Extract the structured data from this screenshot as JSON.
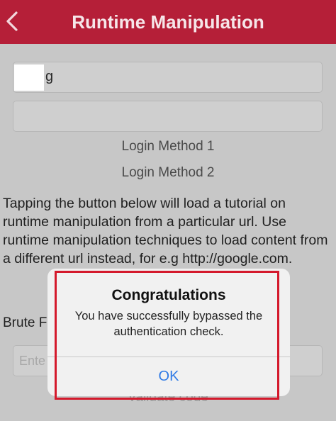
{
  "header": {
    "title": "Runtime Manipulation",
    "back_icon": "chevron-left-icon"
  },
  "form": {
    "username_value": "g",
    "password_value": "",
    "login_method_1": "Login Method 1",
    "login_method_2": "Login Method 2"
  },
  "description": "Tapping the button below will load a tutorial on runtime manipulation from a particular url. Use runtime manipulation techniques to load content from a different url instead, for e.g http://google.com.",
  "brute": {
    "label": "Brute F",
    "placeholder": "Ente",
    "validate_label": "Validate code"
  },
  "alert": {
    "title": "Congratulations",
    "message": "You have successfully bypassed the authentication check.",
    "ok_label": "OK"
  },
  "colors": {
    "navbar": "#b51f38",
    "ok_text": "#2f7ae5",
    "highlight": "#d4192c"
  }
}
